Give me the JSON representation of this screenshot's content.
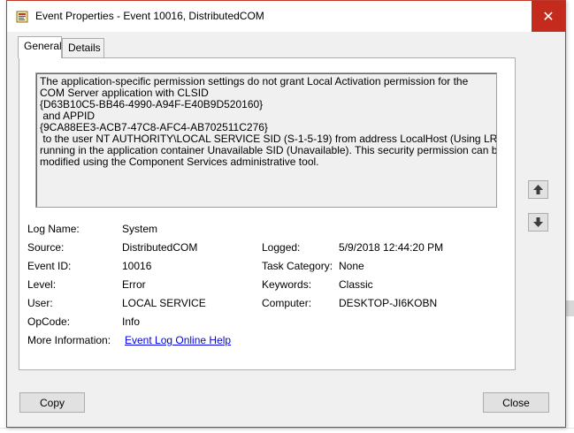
{
  "window": {
    "title": "Event Properties - Event 10016, DistributedCOM",
    "close_glyph": "✕"
  },
  "tabs": [
    {
      "label": "General"
    },
    {
      "label": "Details"
    }
  ],
  "description": {
    "lines": [
      "The application-specific permission settings do not grant Local Activation permission for the",
      "COM Server application with CLSID",
      "{D63B10C5-BB46-4990-A94F-E40B9D520160}",
      " and APPID",
      "{9CA88EE3-ACB7-47C8-AFC4-AB702511C276}",
      " to the user NT AUTHORITY\\LOCAL SERVICE SID (S-1-5-19) from address LocalHost (Using LRPC)",
      "running in the application container Unavailable SID (Unavailable). This security permission can be",
      "modified using the Component Services administrative tool."
    ]
  },
  "fields": {
    "log_name": {
      "label": "Log Name:",
      "value": "System"
    },
    "source": {
      "label": "Source:",
      "value": "DistributedCOM"
    },
    "logged": {
      "label": "Logged:",
      "value": "5/9/2018 12:44:20 PM"
    },
    "event_id": {
      "label": "Event ID:",
      "value": "10016"
    },
    "task_category": {
      "label": "Task Category:",
      "value": "None"
    },
    "level": {
      "label": "Level:",
      "value": "Error"
    },
    "keywords": {
      "label": "Keywords:",
      "value": "Classic"
    },
    "user": {
      "label": "User:",
      "value": "LOCAL SERVICE"
    },
    "computer": {
      "label": "Computer:",
      "value": "DESKTOP-JI6KOBN"
    },
    "opcode": {
      "label": "OpCode:",
      "value": "Info"
    },
    "more_info": {
      "label": "More Information:",
      "value": "Event Log Online Help"
    }
  },
  "buttons": {
    "copy": "Copy",
    "close": "Close"
  },
  "icons": {
    "up": "up-arrow-icon",
    "down": "down-arrow-icon",
    "app": "event-viewer-icon"
  },
  "colors": {
    "close_red": "#c42b1c",
    "link": "#0000ee",
    "arrow_blue": "#1a5fb4"
  }
}
